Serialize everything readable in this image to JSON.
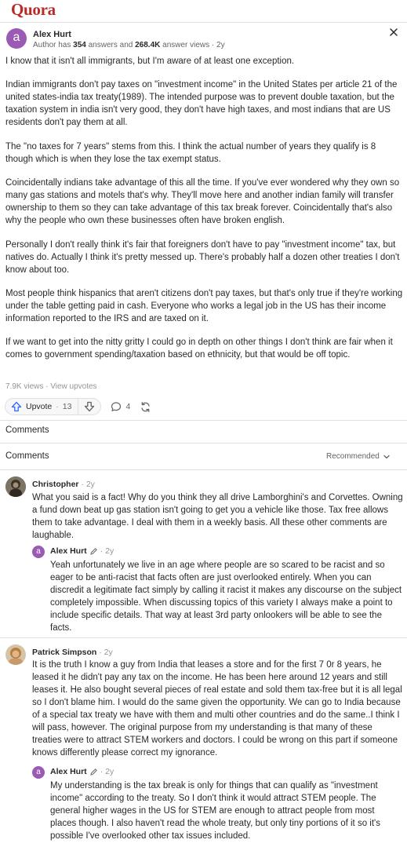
{
  "site": {
    "logo_text": "Quora"
  },
  "answer": {
    "author_name": "Alex Hurt",
    "author_meta_prefix": "Author has ",
    "answers_count": "354",
    "answers_label": " answers and ",
    "answer_views": "268.4K",
    "answer_views_label": " answer views · 2y",
    "avatar_letter": "a",
    "paragraphs": [
      "I know that it isn't all immigrants, but I'm aware of at least one exception.",
      "Indian immigrants don't pay taxes on \"investment income\" in the United States per article 21 of the united states-india tax treaty(1989). The intended purpose was to prevent double taxation, but the taxation system in india isn't very good, they don't have high taxes, and most indians that are US residents don't pay them at all.",
      "The \"no taxes for 7 years\" stems from this. I think the actual number of years they qualify is 8 though which is when they lose the tax exempt status.",
      "Coincidentally indians take advantage of this all the time. If you've ever wondered why they own so many gas stations and motels that's why. They'll move here and another indian family will transfer ownership to them so they can take advantage of this tax break forever. Coincidentally that's also why the people who own these businesses often have broken english.",
      "Personally I don't really think it's fair that foreigners don't have to pay \"investment income\" tax, but natives do. Actually I think it's pretty messed up. There's probably half a dozen other treaties I don't know about too.",
      "Most people think hispanics that aren't citizens don't pay taxes, but that's only true if they're working under the table getting paid in cash. Everyone who works a legal job in the US has their income information reported to the IRS and are taxed on it.",
      "If we want to get into the nitty gritty I could go in depth on other things I don't think are fair when it comes to government spending/taxation based on ethnicity, but that would be off topic."
    ],
    "views_text": "7.9K views · View upvotes",
    "upvote_label": "Upvote",
    "upvote_count": "13",
    "comment_count": "4"
  },
  "comments_section": {
    "header": "Comments",
    "subheader": "Comments",
    "sort_label": "Recommended"
  },
  "comments": [
    {
      "name": "Christopher",
      "time": " · 2y",
      "text": "What you said is a fact! Why do you think they all drive Lamborghini's and Corvettes. Owning a fund down beat up gas station isn't going to get you a vehicle like those. Tax free allows them to take advantage. I deal with them in a weekly basis. All these other comments are laughable.",
      "reply": {
        "name": "Alex Hurt",
        "time": " · 2y",
        "avatar_letter": "a",
        "text": "Yeah unfortunately we live in an age where people are so scared to be racist and so eager to be anti-racist that facts often are just overlooked entirely. When you can discredit a legitimate fact simply by calling it racist it makes any discourse on the subject completely impossible. When discussing topics of this variety I always make a point to include specific details. That way at least 3rd party onlookers will be able to see the facts."
      }
    },
    {
      "name": "Patrick Simpson",
      "time": " · 2y",
      "text": "It is the truth I know a guy from India that leases a store and for the first 7 0r 8 years, he leased it he didn't pay any tax on the income. He has been here around 12 years and still leases it. He also bought several pieces of real estate and sold them tax-free but it is all legal so I don't blame him. I would do the same given the opportunity. We can go to India because of a special tax treaty we have with them and multi other countries and do the same..I think I will pass, however. The original purpose from my understanding is that many of these treaties were to attract STEM workers and doctors. I could be wrong on this part if someone knows differently please correct my ignorance.",
      "reply": {
        "name": "Alex Hurt",
        "time": " · 2y",
        "avatar_letter": "a",
        "text": "My understanding is the tax break is only for things that can qualify as \"investment income\" according to the treaty. So I don't think it would attract STEM people. The general higher wages in the US for STEM are enough to attract people from most places though. I also haven't read the whole treaty, but only tiny portions of it so it's possible I've overlooked other tax issues included."
      }
    }
  ],
  "colors": {
    "brand": "#b92b27",
    "avatar_purple": "#9b5ab3",
    "link_blue": "#2e69ff",
    "text": "#282829",
    "muted": "#636466",
    "divider": "#dee0e1"
  },
  "icons": [
    "close-icon",
    "upvote-icon",
    "downvote-icon",
    "comment-icon",
    "share-icon",
    "chevron-down-icon",
    "edit-pencil-icon"
  ]
}
